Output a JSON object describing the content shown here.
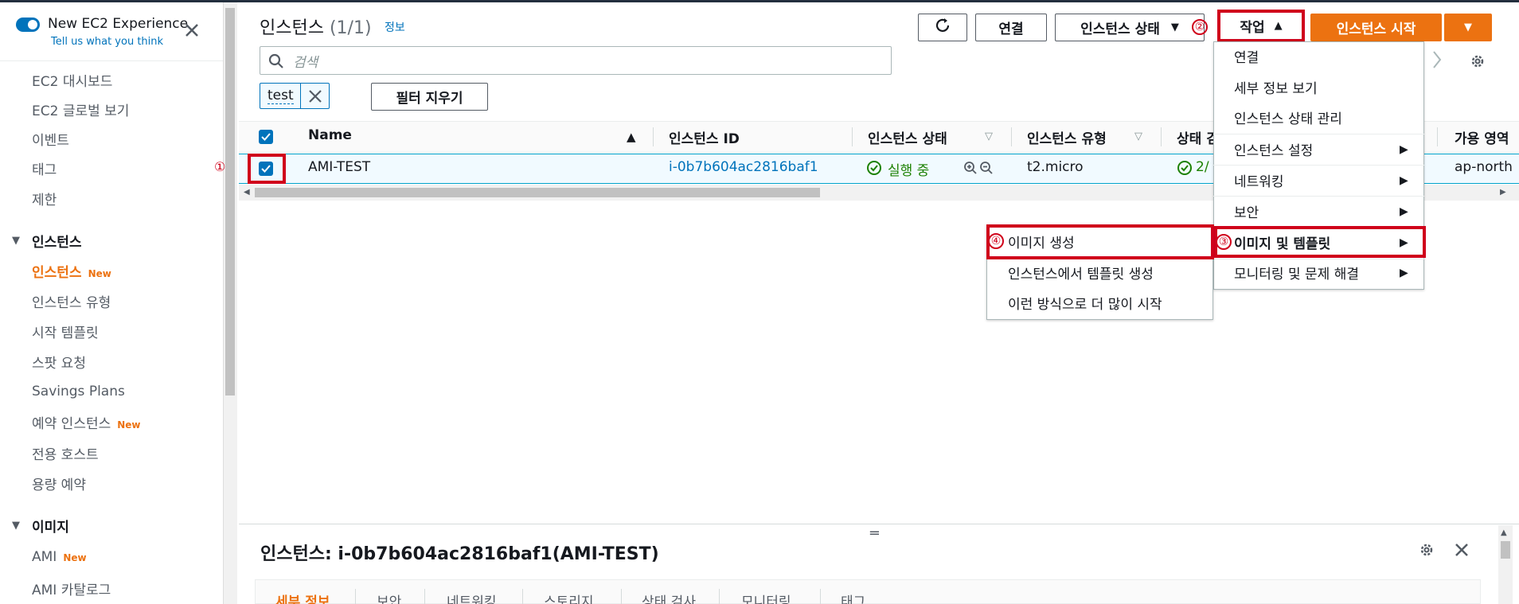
{
  "experience": {
    "label": "New EC2 Experience",
    "feedback": "Tell us what you think"
  },
  "sidebar": {
    "items_top": [
      "EC2 대시보드",
      "EC2 글로벌 보기",
      "이벤트",
      "태그",
      "제한"
    ],
    "instances_section": "인스턴스",
    "instances_items": [
      {
        "label": "인스턴스",
        "badge": "New"
      },
      {
        "label": "인스턴스 유형"
      },
      {
        "label": "시작 템플릿"
      },
      {
        "label": "스팟 요청"
      },
      {
        "label": "Savings Plans"
      },
      {
        "label": "예약 인스턴스",
        "badge": "New"
      },
      {
        "label": "전용 호스트"
      },
      {
        "label": "용량 예약"
      }
    ],
    "images_section": "이미지",
    "images_items": [
      {
        "label": "AMI",
        "badge": "New"
      },
      {
        "label": "AMI 카탈로그"
      }
    ]
  },
  "header": {
    "title": "인스턴스",
    "count": "(1/1)",
    "info": "정보",
    "connect": "연결",
    "instance_state": "인스턴스 상태",
    "actions": "작업",
    "launch": "인스턴스 시작"
  },
  "search": {
    "placeholder": "검색",
    "chip": "test",
    "clear_filters": "필터 지우기"
  },
  "table": {
    "columns": [
      "Name",
      "인스턴스 ID",
      "인스턴스 상태",
      "인스턴스 유형",
      "상태 검",
      "가용 영역"
    ],
    "row": {
      "name": "AMI-TEST",
      "instance_id": "i-0b7b604ac2816baf1",
      "state": "실행 중",
      "type": "t2.micro",
      "status_check": "2/",
      "az": "ap-north"
    }
  },
  "actions_menu": {
    "items": [
      "연결",
      "세부 정보 보기",
      "인스턴스 상태 관리",
      "인스턴스 설정",
      "네트워킹",
      "보안",
      "이미지 및 템플릿",
      "모니터링 및 문제 해결"
    ]
  },
  "image_submenu": {
    "items": [
      "이미지 생성",
      "인스턴스에서 템플릿 생성",
      "이런 방식으로 더 많이 시작"
    ]
  },
  "markers": [
    "①",
    "②",
    "③",
    "④"
  ],
  "details": {
    "title": "인스턴스: i-0b7b604ac2816baf1(AMI-TEST)",
    "tabs": [
      "세부 정보",
      "보안",
      "네트워킹",
      "스토리지",
      "상태 검사",
      "모니터링",
      "태그"
    ]
  },
  "colors": {
    "accent": "#ec7211",
    "link": "#0073bb",
    "marker": "#d0021b",
    "running": "#1d8102"
  }
}
